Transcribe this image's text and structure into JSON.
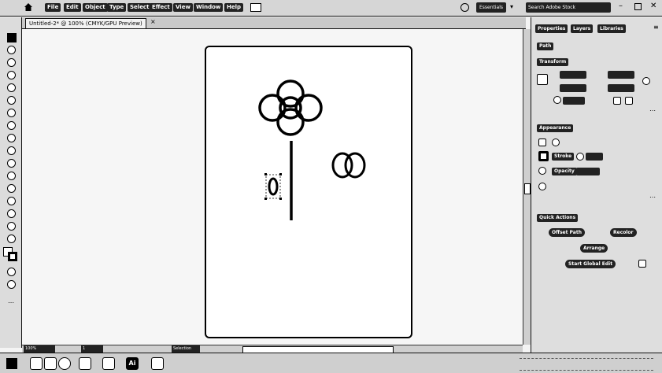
{
  "menu": {
    "items": [
      "File",
      "Edit",
      "Object",
      "Type",
      "Select",
      "Effect",
      "View",
      "Window",
      "Help"
    ],
    "workspace": "Essentials",
    "search_placeholder": "Search Adobe Stock"
  },
  "document": {
    "tab_title": "Untitled-2* @ 100% (CMYK/GPU Preview)",
    "zoom": "100%"
  },
  "panel": {
    "tabs": [
      "Properties",
      "Layers",
      "Libraries"
    ],
    "no_selection": "Path",
    "transform": "Transform",
    "appearance": "Appearance",
    "stroke_label": "Stroke",
    "opacity_label": "Opacity",
    "quick_actions": "Quick Actions",
    "offset_path": "Offset Path",
    "recolor": "Recolor",
    "arrange": "Arrange",
    "start_global_edit": "Start Global Edit"
  },
  "status": {
    "zoom_value": "100%",
    "artboard_num": "1",
    "toggle_label": "Selection"
  }
}
